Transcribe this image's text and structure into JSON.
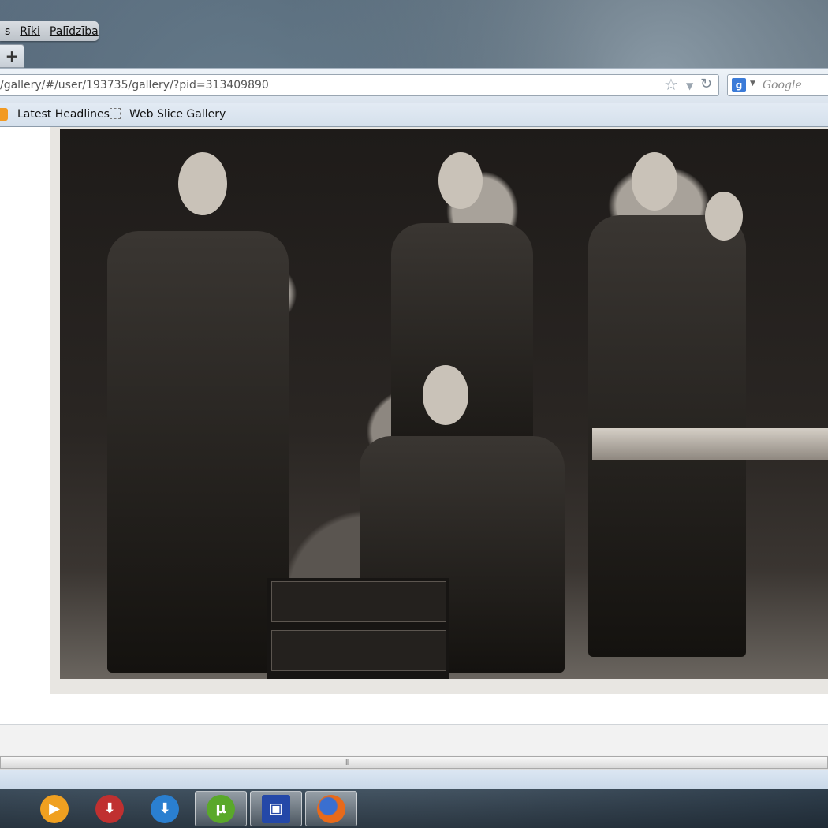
{
  "menu": {
    "items": [
      {
        "label": "s"
      },
      {
        "label": "Rīki"
      },
      {
        "label": "Palīdzība"
      }
    ]
  },
  "tabs": {
    "new_tab_label": "+"
  },
  "navbar": {
    "url": "/gallery/#/user/193735/gallery/?pid=313409890",
    "star_icon": "star-icon",
    "reload_icon": "reload-icon"
  },
  "search": {
    "engine_letter": "g",
    "placeholder": "Google"
  },
  "bookmarks": {
    "items": [
      {
        "label": "Latest Headlines",
        "icon": "rss-icon"
      },
      {
        "label": "Web Slice Gallery",
        "icon": "web-slice-icon"
      }
    ]
  },
  "content": {
    "image_subject": "black and white photo of a band on stage"
  },
  "scrollbar": {
    "grip": "III"
  },
  "taskbar": {
    "buttons": [
      {
        "icon": "media-player-icon",
        "color": "#f0a020",
        "glyph": "▶"
      },
      {
        "icon": "download-tool-icon",
        "color": "#c03030",
        "glyph": "⬇"
      },
      {
        "icon": "download-manager-icon",
        "color": "#2a7fd0",
        "glyph": "⬇"
      },
      {
        "icon": "utorrent-icon",
        "color": "#5aa82a",
        "glyph": "µ"
      },
      {
        "icon": "floppy-save-icon",
        "color": "#2448a8",
        "glyph": "▣"
      },
      {
        "icon": "firefox-icon",
        "color": "#e86a1a",
        "glyph": "●"
      }
    ]
  }
}
